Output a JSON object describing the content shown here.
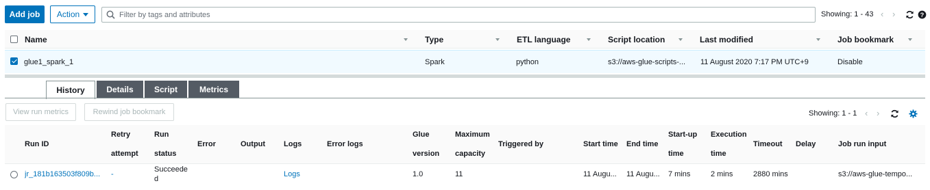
{
  "toolbar": {
    "add_job_label": "Add job",
    "action_label": "Action",
    "search_placeholder": "Filter by tags and attributes",
    "showing": "Showing: 1 - 43"
  },
  "jobs_table": {
    "columns": [
      "Name",
      "Type",
      "ETL language",
      "Script location",
      "Last modified",
      "Job bookmark"
    ],
    "rows": [
      {
        "selected": true,
        "name": "glue1_spark_1",
        "type": "Spark",
        "etl_language": "python",
        "script_location": "s3://aws-glue-scripts-...",
        "last_modified": "11 August 2020 7:17 PM UTC+9",
        "job_bookmark": "Disable"
      }
    ]
  },
  "detail_tabs": {
    "active": "History",
    "tabs": [
      "History",
      "Details",
      "Script",
      "Metrics"
    ]
  },
  "history_toolbar": {
    "view_run_metrics_label": "View run metrics",
    "rewind_bookmark_label": "Rewind job bookmark",
    "showing": "Showing: 1 - 1"
  },
  "runs_table": {
    "headers": {
      "run_id": "Run ID",
      "retry_1": "Retry",
      "retry_2": "attempt",
      "status_1": "Run",
      "status_2": "status",
      "error": "Error",
      "output": "Output",
      "logs": "Logs",
      "error_logs": "Error logs",
      "glue_1": "Glue",
      "glue_2": "version",
      "capacity_1": "Maximum",
      "capacity_2": "capacity",
      "triggered_by": "Triggered by",
      "start_time": "Start time",
      "end_time": "End time",
      "startup_1": "Start-up",
      "startup_2": "time",
      "exec_1": "Execution",
      "exec_2": "time",
      "timeout": "Timeout",
      "delay": "Delay",
      "job_run_input": "Job run input"
    },
    "rows": [
      {
        "run_id": "jr_181b163503f809b...",
        "retry_attempt": "-",
        "run_status_1": "Succeede",
        "run_status_2": "d",
        "logs": "Logs",
        "glue_version": "1.0",
        "max_capacity": "11",
        "start_time": "11 Augu...",
        "end_time": "11 Augu...",
        "startup_time": "7 mins",
        "execution_time": "2 mins",
        "timeout": "2880 mins",
        "job_run_input": "s3://aws-glue-tempo..."
      }
    ]
  },
  "colors": {
    "primary": "#0073bb",
    "selected_row": "#f1faff",
    "tab_inactive": "#545b64"
  }
}
